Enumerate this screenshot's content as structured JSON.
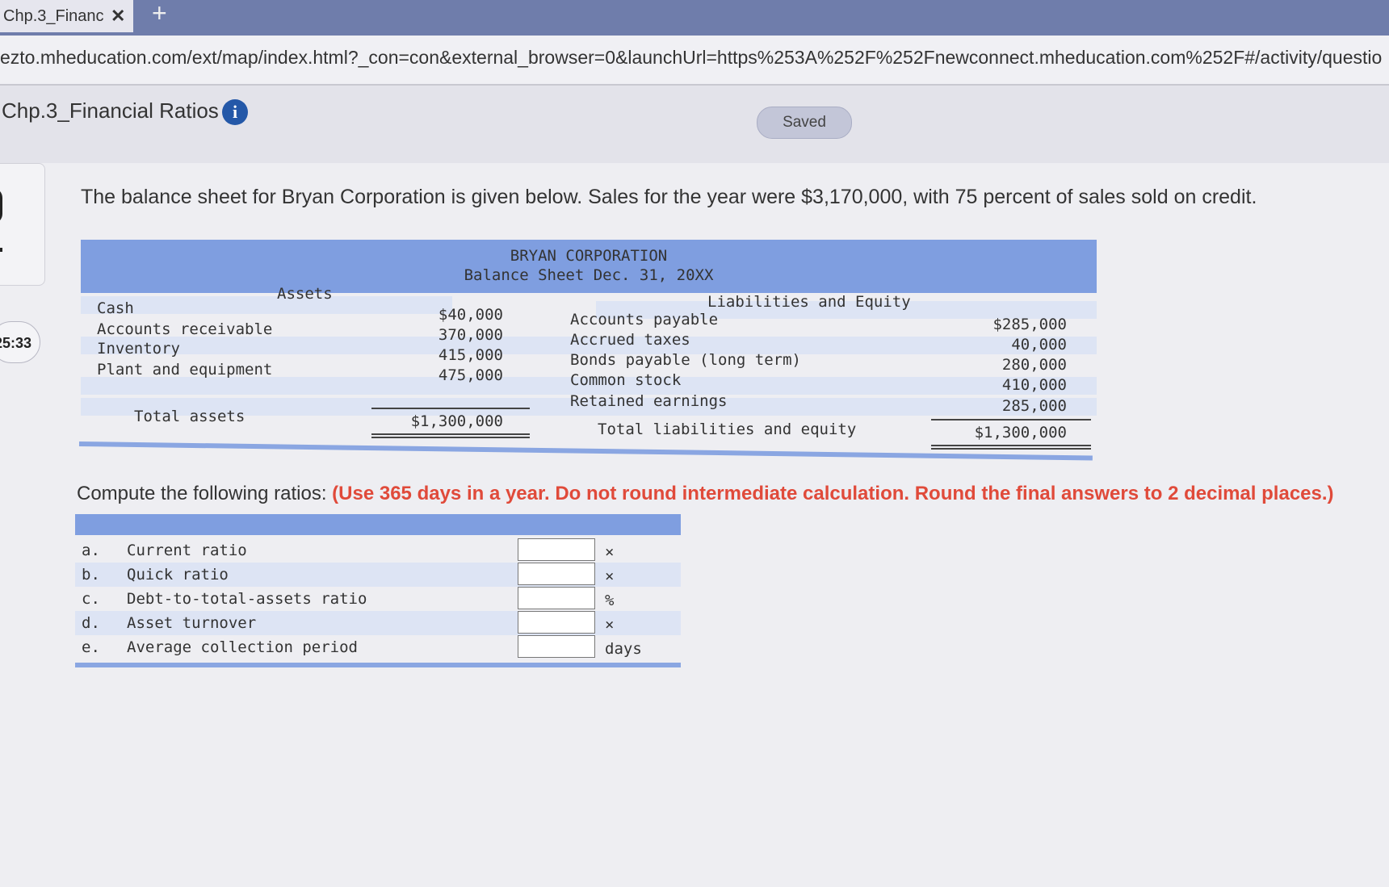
{
  "browser": {
    "tab_title": "Chp.3_Financ",
    "tab_close": "✕",
    "new_tab": "+",
    "url": "ezto.mheducation.com/ext/map/index.html?_con=con&external_browser=0&launchUrl=https%253A%252F%252Fnewconnect.mheducation.com%252F#/activity/questio"
  },
  "assignment": {
    "title": "Chp.3_Financial Ratios",
    "info_icon": "i",
    "saved_label": "Saved",
    "timer": "25:33"
  },
  "question": {
    "prompt": "The balance sheet for Bryan Corporation is given below. Sales for the year were $3,170,000, with 75 percent of sales sold on credit.",
    "instruction_plain": "Compute the following ratios: ",
    "instruction_red": "(Use 365 days in a year. Do not round intermediate calculation. Round the final answers to 2 decimal places.)"
  },
  "balance_sheet": {
    "company": "BRYAN CORPORATION",
    "subtitle": "Balance Sheet Dec. 31, 20XX",
    "assets_header": "Assets",
    "liabilities_header": "Liabilities and Equity",
    "assets": [
      {
        "label": "Cash",
        "value": "$40,000"
      },
      {
        "label": "Accounts receivable",
        "value": "370,000"
      },
      {
        "label": "Inventory",
        "value": "415,000"
      },
      {
        "label": "Plant and equipment",
        "value": "475,000"
      }
    ],
    "liabilities": [
      {
        "label": "Accounts payable",
        "value": "$285,000"
      },
      {
        "label": "Accrued taxes",
        "value": "40,000"
      },
      {
        "label": "Bonds payable (long term)",
        "value": "280,000"
      },
      {
        "label": "Common stock",
        "value": "410,000"
      },
      {
        "label": "Retained earnings",
        "value": "285,000"
      }
    ],
    "total_assets_label": "Total assets",
    "total_assets_value": "$1,300,000",
    "total_le_label": "Total liabilities and equity",
    "total_le_value": "$1,300,000"
  },
  "ratios": [
    {
      "letter": "a.",
      "label": "Current ratio",
      "value": "",
      "unit": "×"
    },
    {
      "letter": "b.",
      "label": "Quick ratio",
      "value": "",
      "unit": "×"
    },
    {
      "letter": "c.",
      "label": "Debt-to-total-assets ratio",
      "value": "",
      "unit": "%"
    },
    {
      "letter": "d.",
      "label": "Asset turnover",
      "value": "",
      "unit": "×"
    },
    {
      "letter": "e.",
      "label": "Average collection period",
      "value": "",
      "unit": "days"
    }
  ]
}
